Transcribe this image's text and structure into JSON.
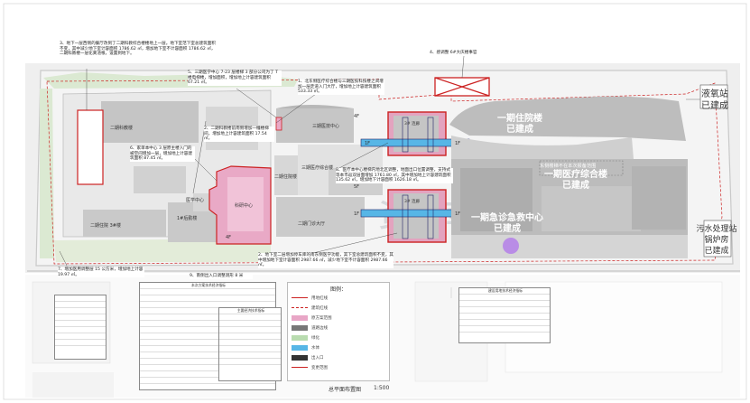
{
  "notes": {
    "n3": "3、地下一层西侧的餐厅改到了二期科教综合楼楼地上一层。地下室范下室总建筑面积不变，其中减少地下室计容面积 1786.62 ㎡，增加地下室不计容面积 1786.62 ㎡，二期科教楼一层化粪池根，设置到地下。",
    "n4": "4、感调整 6#大庆楼事官",
    "n5": "5、三期医学中心 7-23 层楼梯 3 部分公司为了 T 楼电梯楼，增加面积，增加地上计容建筑面积 67.21 ㎡。",
    "n1": "1、北东侧医疗综合楼与三期医技科技楼之间增加一层走道入门大厅，增加地上计容建筑面积 533.33 ㎡。",
    "n2a": "2、二期科教楼前南侧增加一幢楼梯间，增加地上计容建筑面积 17.54 ㎡。",
    "n6": "6、家单本中心 3 层原主楼入门的被空间增加一层，增加地上计容建筑面积 87.45 ㎡。",
    "n8": "8、医疗本中心楼梯内地北区调整，地面出口位置调整，支持式等本市返双层面增加 1761.80 ㎡，其中增加地上计容建筑面积 135.62 ㎡，增加地下计容面积 1626.18 ㎡。",
    "n2b": "2、地下室二层增加停车库的南东侧医学功能，其下室总建筑面积不变，其中增加地下室计容面积 2987.66 ㎡，减少地下室不计容面积 2987.66 ㎡。",
    "n7": "7、增加医用调整层 15 公方米，增加地上计容 19.97 ㎡。",
    "n9": "9、南侧出入口调整测形 8 米"
  },
  "buildings": {
    "inpatient": "一期住院楼",
    "inpatient_status": "已建成",
    "medical_complex": "一期医疗综合楼",
    "medical_complex_status": "已建成",
    "emergency": "一期急诊急救中心",
    "emergency_status": "已建成",
    "oxygen": "液氧站",
    "oxygen_status": "已建成",
    "sewage": "污水处理站",
    "boiler": "锅炉房",
    "sewage_status": "已建成",
    "east_note": "东侧楼梯不在本次报备范围",
    "med_tech": "三期医技中心",
    "science": "二期科教楼",
    "medical_center": "医学中心",
    "medical_center_sub": "科研中心",
    "hall": "二期门诊大厅",
    "east_corridor": "三期医疗综合楼",
    "logistics": "1#后勤楼",
    "ward": "二期住院楼",
    "south": "二期住院 3#楼",
    "bridge_top": "3# 连廊",
    "bridge_bot": "3# 连廊"
  },
  "floors": {
    "f1": "4F",
    "f2": "1F",
    "f3": "1F",
    "f4": "4F",
    "f5": "1F",
    "f6": "5F",
    "f7": "1F"
  },
  "legend": {
    "title": "图例：",
    "items": [
      {
        "label": "用地红线",
        "color": "#cc2222"
      },
      {
        "label": "建筑红线",
        "color": "#cc2222"
      },
      {
        "label": "原方案范围",
        "color": "#e8a6c6"
      },
      {
        "label": "道路边线",
        "color": "#777777"
      },
      {
        "label": "绿化",
        "color": "#b9dcb0"
      },
      {
        "label": "水体",
        "color": "#57b6e6"
      },
      {
        "label": "出入口",
        "color": "#333333"
      },
      {
        "label": "变更范围",
        "color": "#cc2222"
      }
    ]
  },
  "stats_title_left": "本次方案技术经济指标",
  "stats_title_mid": "主要经济技术指标",
  "stats_title_right": "建设用地技术经济指标",
  "north_label": "总平面布置图",
  "scale_label": "1:500"
}
